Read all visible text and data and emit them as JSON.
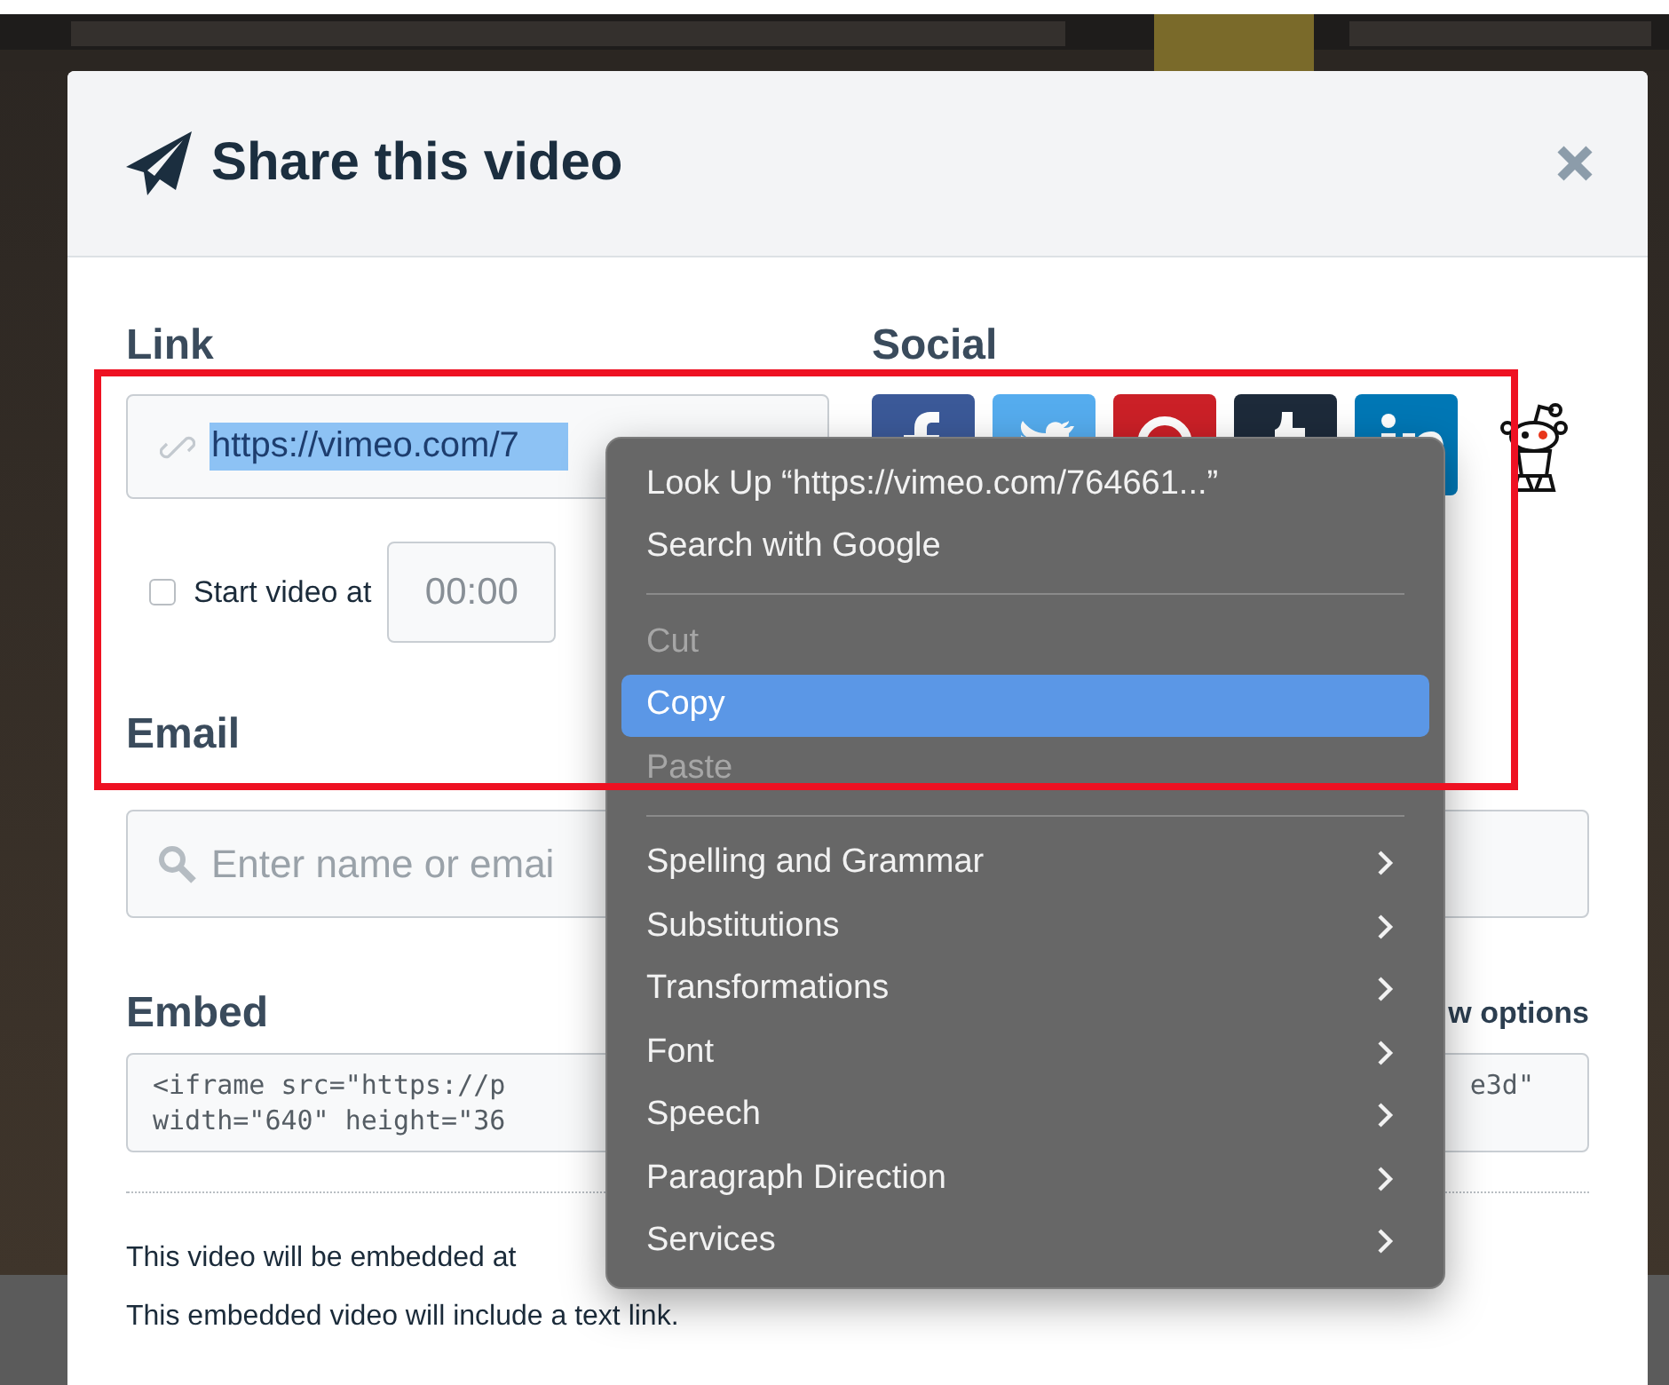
{
  "dialog": {
    "title": "Share this video",
    "link": {
      "heading": "Link",
      "value": "https://vimeo.com/7",
      "text_selected": true
    },
    "start_at": {
      "label": "Start video at",
      "checked": false,
      "time": "00:00"
    },
    "social": {
      "heading": "Social",
      "items": [
        {
          "kind": "facebook",
          "color": "#3b5998"
        },
        {
          "kind": "twitter",
          "color": "#55acee"
        },
        {
          "kind": "pinterest",
          "color": "#cb2027"
        },
        {
          "kind": "tumblr",
          "color": "#1d2a3a"
        },
        {
          "kind": "linkedin",
          "color": "#0077b5"
        },
        {
          "kind": "reddit"
        }
      ]
    },
    "email": {
      "heading": "Email",
      "placeholder": "Enter name or emai"
    },
    "embed": {
      "heading": "Embed",
      "options_link": "w options",
      "code_line_1_start": "<iframe src=\"https://p",
      "code_line_1_end": "e3d\"",
      "code_line_2": "width=\"640\" height=\"36"
    },
    "notes": [
      "This video will be embedded at",
      "This embedded video will include a text link."
    ]
  },
  "context_menu": {
    "items": [
      {
        "kind": "item",
        "label": "Look Up “https://vimeo.com/764661...”",
        "disabled": false,
        "selected": false,
        "submenu": false
      },
      {
        "kind": "item",
        "label": "Search with Google",
        "disabled": false,
        "selected": false,
        "submenu": false
      },
      {
        "kind": "separator"
      },
      {
        "kind": "item",
        "label": "Cut",
        "disabled": true,
        "selected": false,
        "submenu": false
      },
      {
        "kind": "item",
        "label": "Copy",
        "disabled": false,
        "selected": true,
        "submenu": false
      },
      {
        "kind": "item",
        "label": "Paste",
        "disabled": true,
        "selected": false,
        "submenu": false
      },
      {
        "kind": "separator"
      },
      {
        "kind": "item",
        "label": "Spelling and Grammar",
        "disabled": false,
        "selected": false,
        "submenu": true
      },
      {
        "kind": "item",
        "label": "Substitutions",
        "disabled": false,
        "selected": false,
        "submenu": true
      },
      {
        "kind": "item",
        "label": "Transformations",
        "disabled": false,
        "selected": false,
        "submenu": true
      },
      {
        "kind": "item",
        "label": "Font",
        "disabled": false,
        "selected": false,
        "submenu": true
      },
      {
        "kind": "item",
        "label": "Speech",
        "disabled": false,
        "selected": false,
        "submenu": true
      },
      {
        "kind": "item",
        "label": "Paragraph Direction",
        "disabled": false,
        "selected": false,
        "submenu": true
      },
      {
        "kind": "item",
        "label": "Services",
        "disabled": false,
        "selected": false,
        "submenu": true
      }
    ]
  }
}
